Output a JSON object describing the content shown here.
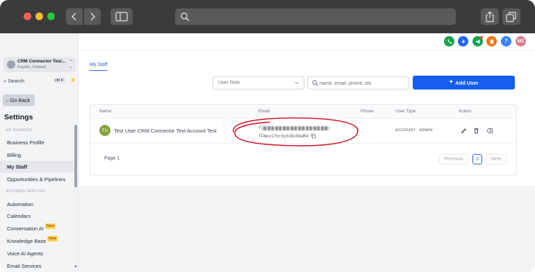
{
  "browser": {
    "icons": {
      "back": "chevron-left-icon",
      "forward": "chevron-right-icon",
      "sidebar": "sidebar-icon",
      "search": "search-icon",
      "share": "share-icon",
      "tabs": "tabs-icon"
    }
  },
  "sidebar": {
    "account": {
      "name": "CRM Connector Test...",
      "location": "Kapelle, Zeeland"
    },
    "search": {
      "label": "Search",
      "shortcut": "ctrl K"
    },
    "go_back": "Go Back",
    "title": "Settings",
    "sections": [
      {
        "label": "MY BUSINESS"
      },
      {
        "label": "BUSINESS SERVICES"
      }
    ],
    "items": [
      {
        "label": "Business Profile"
      },
      {
        "label": "Billing"
      },
      {
        "label": "My Staff",
        "active": true
      },
      {
        "label": "Opportunities & Pipelines"
      },
      {
        "label": "Automation"
      },
      {
        "label": "Calendars"
      },
      {
        "label": "Conversation AI",
        "badge": "New"
      },
      {
        "label": "Knowledge Base",
        "badge": "New"
      },
      {
        "label": "Voice AI Agents"
      },
      {
        "label": "Email Services"
      }
    ]
  },
  "topbar": {
    "icons": [
      {
        "name": "phone-icon",
        "color": "#16a34a"
      },
      {
        "name": "sparkle-icon",
        "color": "#2563eb"
      },
      {
        "name": "megaphone-icon",
        "color": "#16a34a"
      },
      {
        "name": "bell-icon",
        "color": "#f97316"
      },
      {
        "name": "help-icon",
        "color": "#3b82f6",
        "glyph": "?"
      }
    ],
    "avatar": {
      "initials": "MZ",
      "color": "#d97e8f"
    }
  },
  "main": {
    "tab": "My Staff",
    "filters": {
      "role_placeholder": "User Role",
      "search_placeholder": "name, email, phone, ids",
      "add_user_label": "Add User"
    },
    "table": {
      "columns": [
        "Name",
        "Email",
        "Phone",
        "User Type",
        "Action"
      ],
      "rows": [
        {
          "initials": "TU",
          "name": "Test User CRM Connector Test Account Test",
          "email_prefix": "f",
          "email_id": "TFNev17hr0y638z8bdR4",
          "phone": "",
          "user_type": "ACCOUNT - ADMIN"
        }
      ]
    },
    "pagination": {
      "page_label": "Page 1",
      "prev": "Previous",
      "current": "1",
      "next": "Next"
    }
  },
  "annotation": {
    "color": "#d11a2a"
  }
}
